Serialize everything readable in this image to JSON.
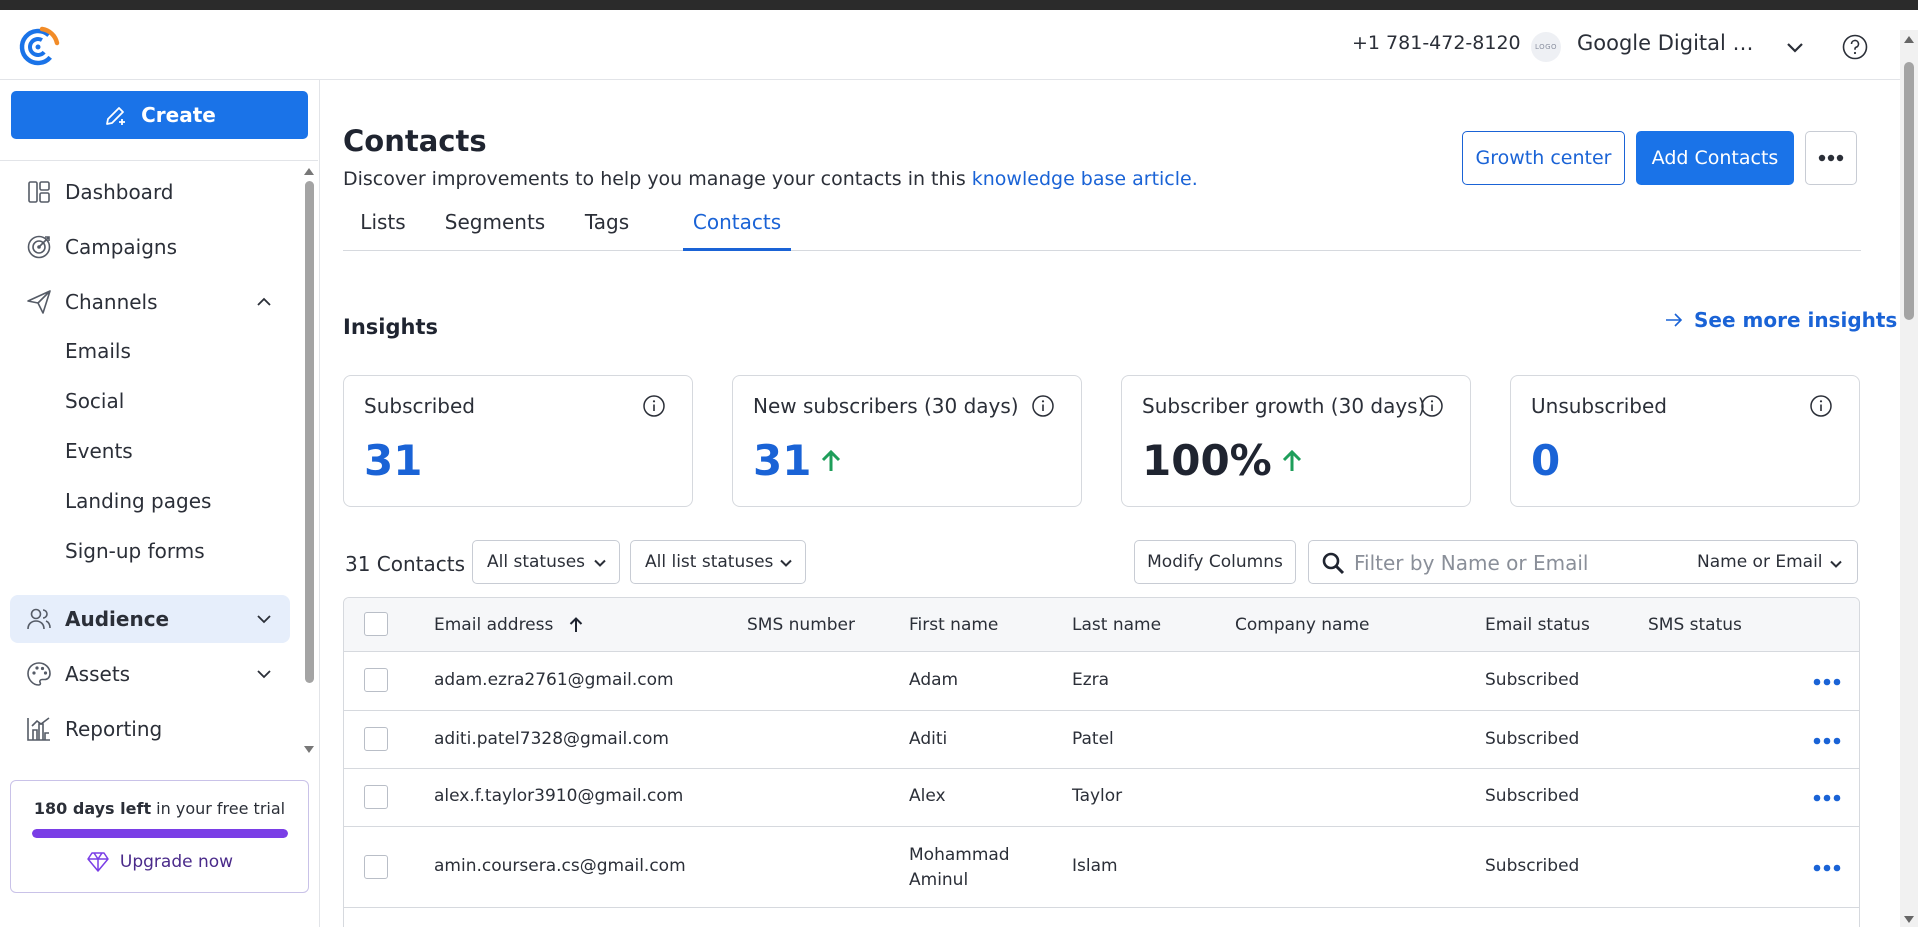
{
  "header": {
    "phone": "+1 781-472-8120",
    "account_logo_text": "LOGO",
    "account_name": "Google Digital Marketing"
  },
  "sidebar": {
    "create_label": "Create",
    "items": [
      {
        "label": "Dashboard",
        "icon": "dashboard-icon"
      },
      {
        "label": "Campaigns",
        "icon": "campaigns-icon"
      },
      {
        "label": "Channels",
        "icon": "paper-plane-icon",
        "expanded": true
      },
      {
        "label": "Audience",
        "icon": "users-icon",
        "active": true
      },
      {
        "label": "Assets",
        "icon": "palette-icon"
      },
      {
        "label": "Reporting",
        "icon": "chart-icon"
      }
    ],
    "channels_sub": [
      "Emails",
      "Social",
      "Events",
      "Landing pages",
      "Sign-up forms"
    ],
    "trial": {
      "days_bold": "180 days left",
      "rest": " in your free trial",
      "progress": 1.0,
      "upgrade_label": "Upgrade now"
    }
  },
  "page": {
    "title": "Contacts",
    "desc_prefix": "Discover improvements to help you manage your contacts in this ",
    "desc_link": "knowledge base article.",
    "growth_center_label": "Growth center",
    "add_contacts_label": "Add Contacts",
    "tabs": [
      "Lists",
      "Segments",
      "Tags",
      "Contacts"
    ],
    "active_tab": "Contacts"
  },
  "insights": {
    "title": "Insights",
    "see_more": "See more insights",
    "cards": [
      {
        "label": "Subscribed",
        "value": "31",
        "trend": "none"
      },
      {
        "label": "New subscribers (30 days)",
        "value": "31",
        "trend": "up"
      },
      {
        "label": "Subscriber growth (30 days)",
        "value": "100%",
        "trend": "up"
      },
      {
        "label": "Unsubscribed",
        "value": "0",
        "trend": "none"
      }
    ]
  },
  "toolbar": {
    "count": "31 Contacts",
    "status_filter": "All statuses",
    "list_status_filter": "All list statuses",
    "modify_columns": "Modify Columns",
    "search_placeholder": "Filter by Name or Email",
    "search_field": "Name or Email"
  },
  "table": {
    "columns": [
      "Email address",
      "SMS number",
      "First name",
      "Last name",
      "Company name",
      "Email status",
      "SMS status"
    ],
    "sorted_column": "Email address",
    "sort_direction": "ascending",
    "rows": [
      {
        "email": "adam.ezra2761@gmail.com",
        "sms": "",
        "first": "Adam",
        "last": "Ezra",
        "company": "",
        "email_status": "Subscribed",
        "sms_status": ""
      },
      {
        "email": "aditi.patel7328@gmail.com",
        "sms": "",
        "first": "Aditi",
        "last": "Patel",
        "company": "",
        "email_status": "Subscribed",
        "sms_status": ""
      },
      {
        "email": "alex.f.taylor3910@gmail.com",
        "sms": "",
        "first": "Alex",
        "last": "Taylor",
        "company": "",
        "email_status": "Subscribed",
        "sms_status": ""
      },
      {
        "email": "amin.coursera.cs@gmail.com",
        "sms": "",
        "first": "Mohammad Aminul",
        "last": "Islam",
        "company": "",
        "email_status": "Subscribed",
        "sms_status": ""
      }
    ]
  },
  "colors": {
    "primary": "#1a73e8",
    "link": "#1a63d6",
    "trend_up": "#1e9e5a",
    "trial_purple": "#7a3ee6",
    "active_nav_bg": "#e6eefb"
  }
}
